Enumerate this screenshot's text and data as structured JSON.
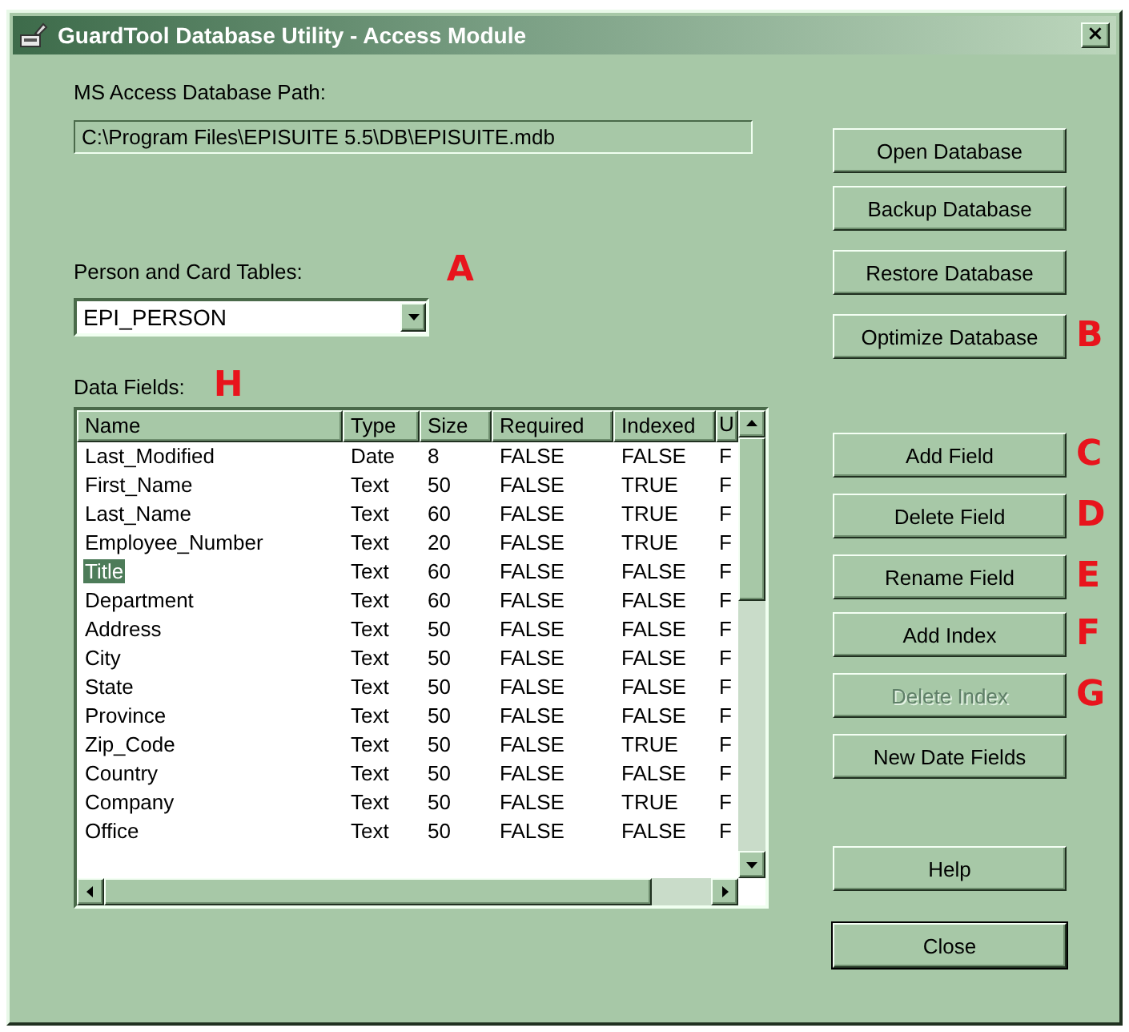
{
  "window": {
    "title": "GuardTool Database Utility - Access Module",
    "close": "×"
  },
  "path": {
    "label": "MS Access Database Path:",
    "value": "C:\\Program Files\\EPISUITE 5.5\\DB\\EPISUITE.mdb"
  },
  "tables": {
    "label": "Person and Card Tables:",
    "value": "EPI_PERSON",
    "marker": "A"
  },
  "fields": {
    "label": "Data Fields:",
    "marker": "H",
    "columns": [
      "Name",
      "Type",
      "Size",
      "Required",
      "Indexed",
      "U"
    ],
    "rows": [
      {
        "cells": [
          "Last_Modified",
          "Date",
          "8",
          "FALSE",
          "FALSE",
          "F"
        ],
        "selected": false
      },
      {
        "cells": [
          "First_Name",
          "Text",
          "50",
          "FALSE",
          "TRUE",
          "F"
        ],
        "selected": false
      },
      {
        "cells": [
          "Last_Name",
          "Text",
          "60",
          "FALSE",
          "TRUE",
          "F"
        ],
        "selected": false
      },
      {
        "cells": [
          "Employee_Number",
          "Text",
          "20",
          "FALSE",
          "TRUE",
          "F"
        ],
        "selected": false
      },
      {
        "cells": [
          "Title",
          "Text",
          "60",
          "FALSE",
          "FALSE",
          "F"
        ],
        "selected": true
      },
      {
        "cells": [
          "Department",
          "Text",
          "60",
          "FALSE",
          "FALSE",
          "F"
        ],
        "selected": false
      },
      {
        "cells": [
          "Address",
          "Text",
          "50",
          "FALSE",
          "FALSE",
          "F"
        ],
        "selected": false
      },
      {
        "cells": [
          "City",
          "Text",
          "50",
          "FALSE",
          "FALSE",
          "F"
        ],
        "selected": false
      },
      {
        "cells": [
          "State",
          "Text",
          "50",
          "FALSE",
          "FALSE",
          "F"
        ],
        "selected": false
      },
      {
        "cells": [
          "Province",
          "Text",
          "50",
          "FALSE",
          "FALSE",
          "F"
        ],
        "selected": false
      },
      {
        "cells": [
          "Zip_Code",
          "Text",
          "50",
          "FALSE",
          "TRUE",
          "F"
        ],
        "selected": false
      },
      {
        "cells": [
          "Country",
          "Text",
          "50",
          "FALSE",
          "FALSE",
          "F"
        ],
        "selected": false
      },
      {
        "cells": [
          "Company",
          "Text",
          "50",
          "FALSE",
          "TRUE",
          "F"
        ],
        "selected": false
      },
      {
        "cells": [
          "Office",
          "Text",
          "50",
          "FALSE",
          "FALSE",
          "F"
        ],
        "selected": false
      }
    ]
  },
  "buttons": [
    {
      "label": "Open Database",
      "disabled": false,
      "default": false
    },
    {
      "label": "Backup Database",
      "disabled": false,
      "default": false
    },
    {
      "label": "Restore Database",
      "disabled": false,
      "default": false
    },
    {
      "label": "Optimize Database",
      "disabled": false,
      "default": false,
      "marker": "B"
    },
    {
      "label": "Add Field",
      "disabled": false,
      "default": false,
      "marker": "C"
    },
    {
      "label": "Delete Field",
      "disabled": false,
      "default": false,
      "marker": "D"
    },
    {
      "label": "Rename Field",
      "disabled": false,
      "default": false,
      "marker": "E"
    },
    {
      "label": "Add Index",
      "disabled": false,
      "default": false,
      "marker": "F"
    },
    {
      "label": "Delete Index",
      "disabled": true,
      "default": false,
      "marker": "G"
    },
    {
      "label": "New Date Fields",
      "disabled": false,
      "default": false
    },
    {
      "label": "Help",
      "disabled": false,
      "default": false
    },
    {
      "label": "Close",
      "disabled": false,
      "default": true
    }
  ]
}
